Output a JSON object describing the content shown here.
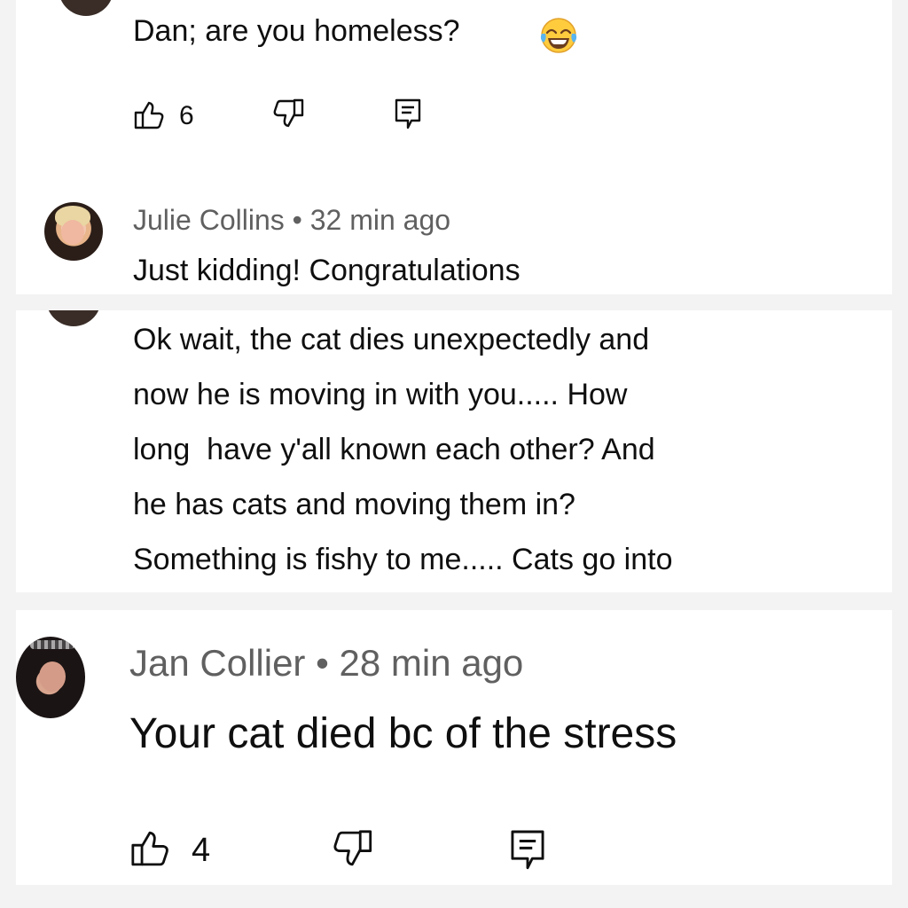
{
  "comments": [
    {
      "text": "Dan; are you homeless?",
      "emoji": "tears-of-joy-emoji",
      "likes": "6"
    },
    {
      "author": "Julie Collins",
      "separator": "•",
      "time": "32 min ago",
      "text": "Just kidding! Congratulations"
    },
    {
      "lines": [
        "Ok wait, the cat dies unexpectedly and",
        "now he is moving in with you..... How",
        "long  have y'all known each other? And",
        "he has cats and moving them in?",
        "Something is fishy to me..... Cats go into"
      ]
    },
    {
      "author": "Jan Collier",
      "separator": "•",
      "time": "28 min ago",
      "text": "Your cat died bc of the stress",
      "likes": "4"
    }
  ],
  "icons": [
    "thumbs-up-icon",
    "thumbs-down-icon",
    "reply-icon"
  ],
  "colors": {
    "text": "#0f0f0f",
    "meta": "#606060",
    "background": "#f3f3f3",
    "card": "#ffffff"
  }
}
